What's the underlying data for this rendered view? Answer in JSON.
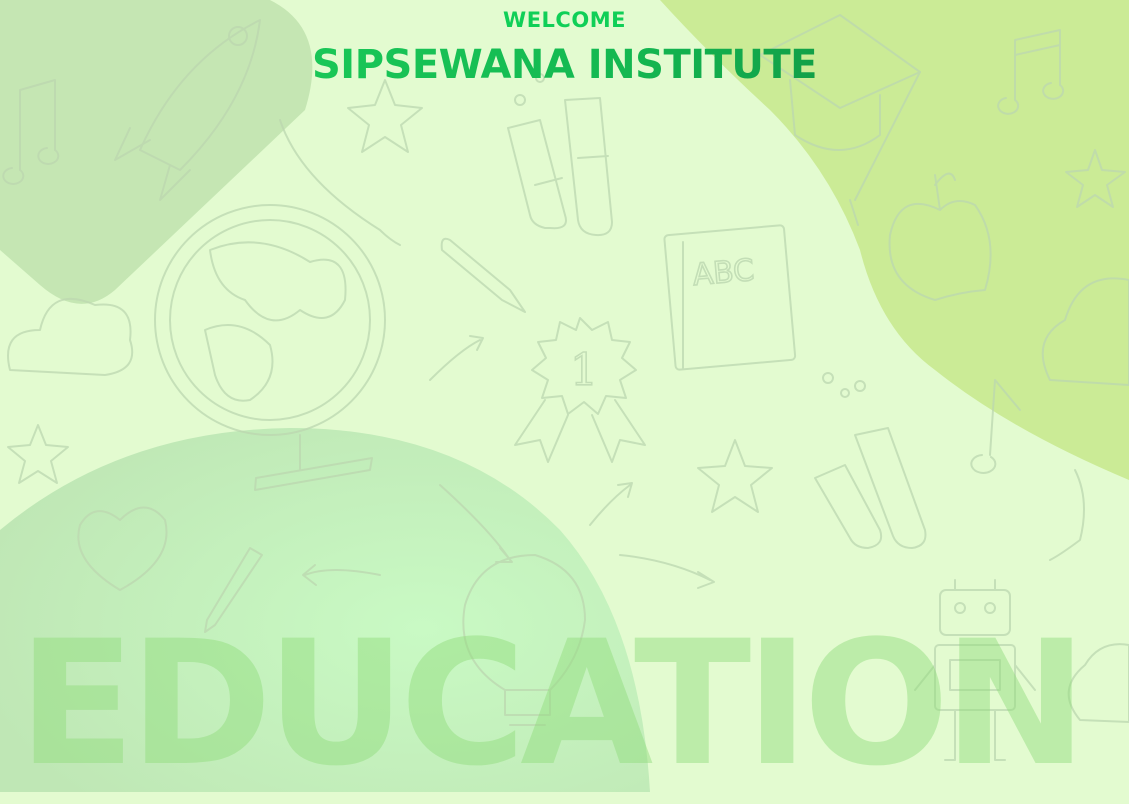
{
  "header": {
    "welcome": "WELCOME",
    "title": "SIPSEWANA INSTITUTE"
  },
  "watermark": {
    "word": "EDUCATION"
  },
  "doodles": {
    "book_label": "ABC",
    "badge_label": "1"
  },
  "colors": {
    "background": "#e3fbd0",
    "welcome": "#10cf57",
    "title_start": "#1fd55d",
    "title_end": "#0d7a3a",
    "blob_top_left": "#c5e6b3",
    "blob_top_right": "#cbeb96",
    "blob_bottom_left": "#b7efb7"
  }
}
